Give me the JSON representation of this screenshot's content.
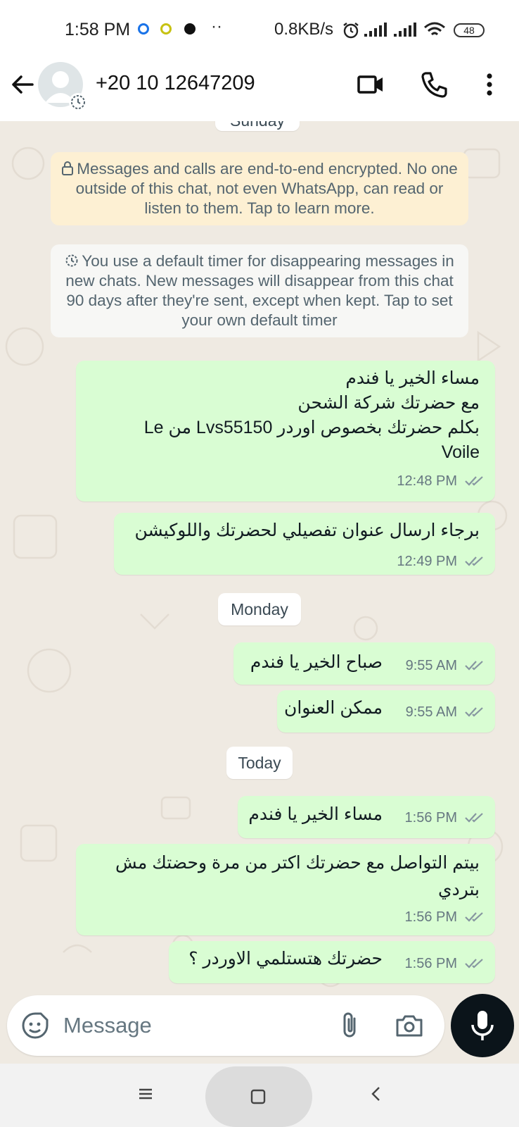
{
  "status_bar": {
    "time": "1:58 PM",
    "net_speed": "0.8KB/s",
    "battery": "48"
  },
  "header": {
    "contact_name": "+20 10 12647209",
    "icons": [
      "back-arrow-icon",
      "avatar-placeholder",
      "disappearing-timer-icon",
      "video-call-icon",
      "voice-call-icon",
      "more-vert-icon"
    ]
  },
  "chat": {
    "top_day_label": "Sunday",
    "encryption_notice": "Messages and calls are end-to-end encrypted. No one outside of this chat, not even WhatsApp, can read or listen to them. Tap to learn more.",
    "timer_notice": "You use a default timer for disappearing messages in new chats. New messages will disappear from this chat 90 days after they're sent, except when kept. Tap to set your own default timer",
    "days": {
      "monday": "Monday",
      "today": "Today"
    },
    "messages": [
      {
        "line1": "مساء الخير يا فندم",
        "line2": "مع حضرتك شركة الشحن",
        "line3": "بكلم حضرتك بخصوص اوردر Lvs55150 من Le",
        "line4": "Voile",
        "time": "12:48 PM"
      },
      {
        "line1": "برجاء ارسال عنوان تفصيلي لحضرتك واللوكيشن",
        "time": "12:49 PM"
      },
      {
        "line1": "صباح الخير يا فندم",
        "time": "9:55 AM"
      },
      {
        "line1": "ممكن العنوان",
        "time": "9:55 AM"
      },
      {
        "line1": "مساء الخير يا فندم",
        "time": "1:56 PM"
      },
      {
        "line1": "بيتم التواصل مع حضرتك اكتر من مرة وحضتك مش",
        "line2": "بتردي",
        "time": "1:56 PM"
      },
      {
        "line1": "حضرتك هتستلمي الاوردر ؟",
        "time": "1:56 PM"
      }
    ]
  },
  "input": {
    "placeholder": "Message",
    "icons": [
      "emoji-sticker-icon",
      "attach-icon",
      "camera-icon",
      "mic-icon"
    ]
  },
  "colors": {
    "outgoing_bubble": "#d9fdd3",
    "wallpaper": "#efeae2",
    "encryption_note": "#fdf0d3",
    "mic_button": "#0b141a"
  }
}
